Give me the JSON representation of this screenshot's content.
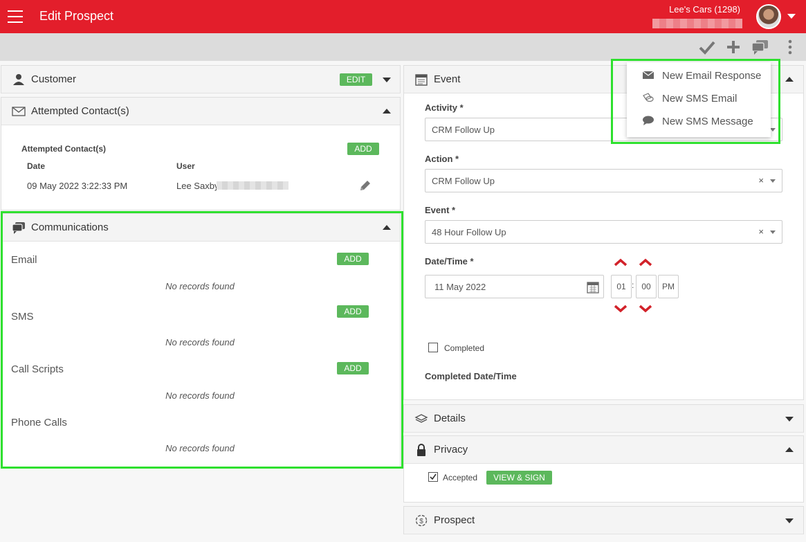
{
  "header": {
    "title": "Edit Prospect",
    "company": "Lee's Cars (1298)"
  },
  "customer": {
    "title": "Customer",
    "edit_label": "EDIT"
  },
  "attempted": {
    "title": "Attempted Contact(s)",
    "section_label": "Attempted Contact(s)",
    "add_label": "ADD",
    "columns": [
      "Date",
      "User"
    ],
    "rows": [
      {
        "date": "09 May 2022 3:22:33 PM",
        "user": "Lee Saxby"
      }
    ]
  },
  "communications": {
    "title": "Communications",
    "sections": [
      {
        "label": "Email",
        "add_label": "ADD",
        "empty": "No records found"
      },
      {
        "label": "SMS",
        "add_label": "ADD",
        "empty": "No records found"
      },
      {
        "label": "Call Scripts",
        "add_label": "ADD",
        "empty": "No records found"
      },
      {
        "label": "Phone Calls",
        "empty": "No records found"
      }
    ]
  },
  "event": {
    "title": "Event",
    "activity_label": "Activity *",
    "activity_value": "CRM Follow Up",
    "action_label": "Action *",
    "action_value": "CRM Follow Up",
    "event_label": "Event *",
    "event_value": "48 Hour Follow Up",
    "datetime_label": "Date/Time *",
    "date_value": "11 May 2022",
    "hour": "01",
    "minute": "00",
    "meridian": "PM",
    "completed_label": "Completed",
    "completed_dt_label": "Completed Date/Time",
    "clear_glyph": "×"
  },
  "details": {
    "title": "Details"
  },
  "privacy": {
    "title": "Privacy",
    "accepted_label": "Accepted",
    "view_sign_label": "VIEW & SIGN"
  },
  "prospect": {
    "title": "Prospect"
  },
  "menu": {
    "items": [
      {
        "label": "New Email Response",
        "icon": "envelope-icon"
      },
      {
        "label": "New SMS Email",
        "icon": "sms-email-icon"
      },
      {
        "label": "New SMS Message",
        "icon": "chat-bubble-icon"
      }
    ]
  },
  "colors": {
    "brand": "#e31e2b",
    "accent_green": "#5cb85c",
    "highlight": "#2ee02e"
  }
}
